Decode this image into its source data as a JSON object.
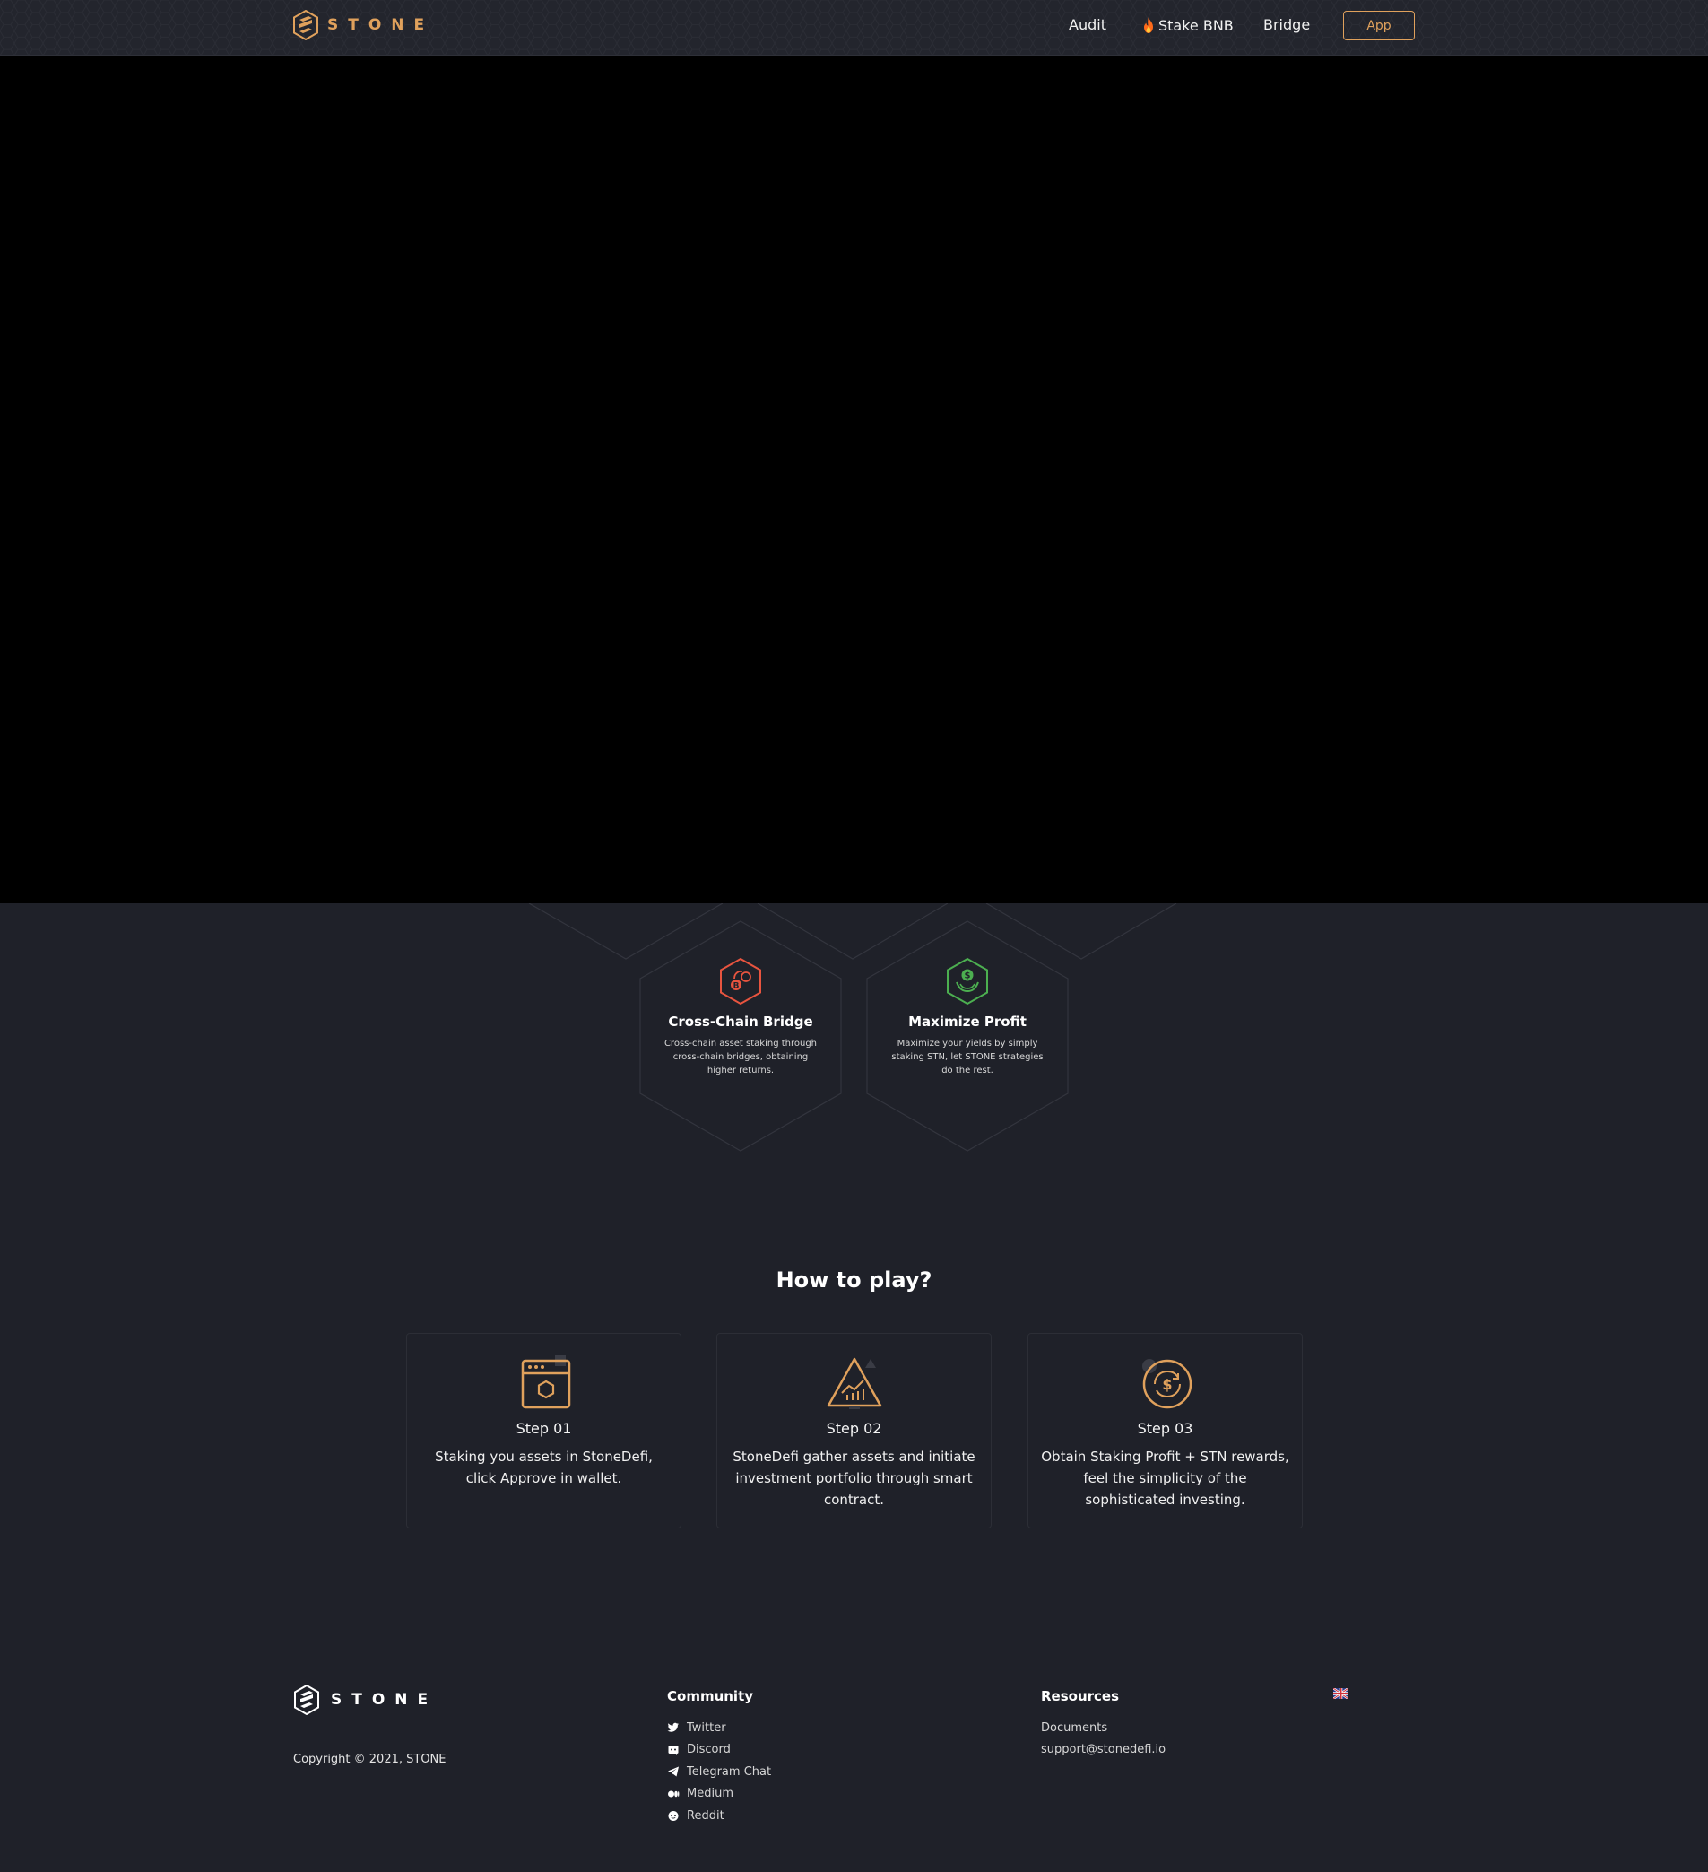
{
  "header": {
    "brand": "STONE",
    "nav": {
      "audit": "Audit",
      "stake": "Stake BNB",
      "bridge": "Bridge"
    },
    "app_button": "App"
  },
  "features": [
    {
      "icon": "bridge-icon",
      "title": "Cross-Chain Bridge",
      "description": "Cross-chain asset staking through cross-chain bridges, obtaining higher returns.",
      "color": "#e8543f"
    },
    {
      "icon": "profit-icon",
      "title": "Maximize Profit",
      "description": "Maximize your yields by simply staking STN, let STONE strategies do the rest.",
      "color": "#4caf50"
    }
  ],
  "how_to_play": {
    "title": "How to play?",
    "steps": [
      {
        "icon": "wallet-window-icon",
        "title": "Step 01",
        "description": "Staking you assets in StoneDefi, click Approve in wallet."
      },
      {
        "icon": "chart-triangle-icon",
        "title": "Step 02",
        "description": "StoneDefi gather assets and initiate investment portfolio through smart contract."
      },
      {
        "icon": "dollar-cycle-icon",
        "title": "Step 03",
        "description": "Obtain Staking Profit + STN rewards, feel the simplicity of the sophisticated investing."
      }
    ]
  },
  "footer": {
    "brand": "STONE",
    "copyright": "Copyright © 2021, STONE",
    "community": {
      "heading": "Community",
      "links": [
        "Twitter",
        "Discord",
        "Telegram Chat",
        "Medium",
        "Reddit"
      ]
    },
    "resources": {
      "heading": "Resources",
      "links": [
        "Documents",
        "support@stonedefi.io"
      ]
    },
    "language_icon": "uk-flag-icon"
  },
  "colors": {
    "accent": "#e0a15c",
    "background": "#1f2129",
    "hero": "#000000"
  }
}
